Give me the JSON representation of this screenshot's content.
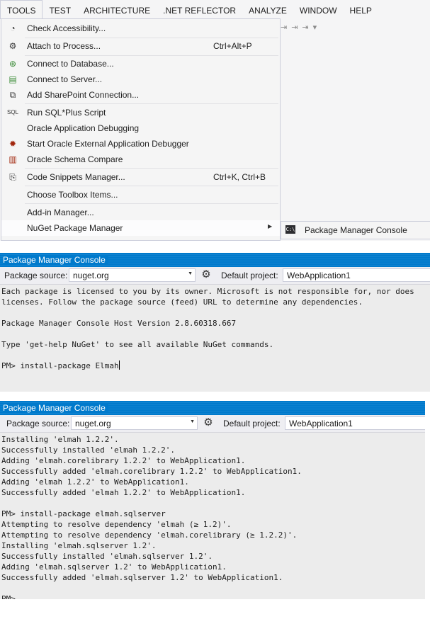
{
  "menubar": {
    "items": [
      {
        "label": "TOOLS"
      },
      {
        "label": "TEST"
      },
      {
        "label": "ARCHITECTURE"
      },
      {
        "label": ".NET REFLECTOR"
      },
      {
        "label": "ANALYZE"
      },
      {
        "label": "WINDOW"
      },
      {
        "label": "HELP"
      }
    ]
  },
  "tools_menu": {
    "items": [
      {
        "label": "Check Accessibility...",
        "shortcut": "",
        "icon": "accessibility-icon"
      },
      {
        "label": "Attach to Process...",
        "shortcut": "Ctrl+Alt+P",
        "icon": "attach-process-icon"
      },
      {
        "label": "Connect to Database...",
        "shortcut": "",
        "icon": "connect-database-icon"
      },
      {
        "label": "Connect to Server...",
        "shortcut": "",
        "icon": "connect-server-icon"
      },
      {
        "label": "Add SharePoint Connection...",
        "shortcut": "",
        "icon": "sharepoint-icon"
      },
      {
        "label": "Run SQL*Plus Script",
        "shortcut": "",
        "icon": "sqlplus-icon"
      },
      {
        "label": "Oracle Application Debugging",
        "shortcut": "",
        "icon": ""
      },
      {
        "label": "Start Oracle External Application Debugger",
        "shortcut": "",
        "icon": "oracle-debugger-icon"
      },
      {
        "label": "Oracle Schema Compare",
        "shortcut": "",
        "icon": "schema-compare-icon"
      },
      {
        "label": "Code Snippets Manager...",
        "shortcut": "Ctrl+K, Ctrl+B",
        "icon": "code-snippets-icon"
      },
      {
        "label": "Choose Toolbox Items...",
        "shortcut": "",
        "icon": ""
      },
      {
        "label": "Add-in Manager...",
        "shortcut": "",
        "icon": ""
      },
      {
        "label": "NuGet Package Manager",
        "shortcut": "",
        "icon": ""
      }
    ]
  },
  "submenu": {
    "item": {
      "label": "Package Manager Console",
      "icon": "console-icon"
    }
  },
  "console1": {
    "title": "Package Manager Console",
    "source_label": "Package source:",
    "source_value": "nuget.org",
    "project_label": "Default project:",
    "project_value": "WebApplication1",
    "lines": [
      "Each package is licensed to you by its owner. Microsoft is not responsible for, nor does",
      "licenses. Follow the package source (feed) URL to determine any dependencies.",
      "",
      "Package Manager Console Host Version 2.8.60318.667",
      "",
      "Type 'get-help NuGet' to see all available NuGet commands.",
      "",
      "PM> install-package Elmah"
    ]
  },
  "console2": {
    "title": "Package Manager Console",
    "source_label": "Package source:",
    "source_value": "nuget.org",
    "project_label": "Default project:",
    "project_value": "WebApplication1",
    "lines": [
      "Installing 'elmah 1.2.2'.",
      "Successfully installed 'elmah 1.2.2'.",
      "Adding 'elmah.corelibrary 1.2.2' to WebApplication1.",
      "Successfully added 'elmah.corelibrary 1.2.2' to WebApplication1.",
      "Adding 'elmah 1.2.2' to WebApplication1.",
      "Successfully added 'elmah 1.2.2' to WebApplication1.",
      "",
      "PM> install-package elmah.sqlserver",
      "Attempting to resolve dependency 'elmah (≥ 1.2)'.",
      "Attempting to resolve dependency 'elmah.corelibrary (≥ 1.2.2)'.",
      "Installing 'elmah.sqlserver 1.2'.",
      "Successfully installed 'elmah.sqlserver 1.2'.",
      "Adding 'elmah.sqlserver 1.2' to WebApplication1.",
      "Successfully added 'elmah.sqlserver 1.2' to WebApplication1.",
      "",
      "PM>"
    ]
  }
}
